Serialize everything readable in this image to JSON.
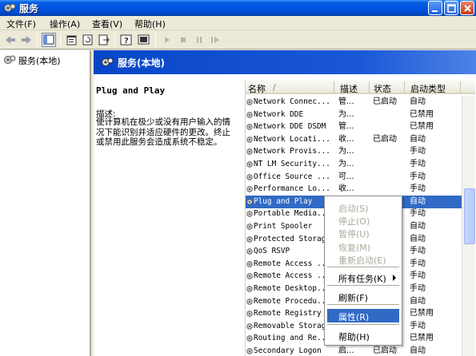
{
  "window": {
    "title": "服务",
    "accent": "#0054e3"
  },
  "menubar": {
    "items": [
      "文件(F)",
      "操作(A)",
      "查看(V)",
      "帮助(H)"
    ]
  },
  "toolbar": {
    "icons": [
      "back-arrow-icon",
      "forward-arrow-icon",
      "show-hide-tree-icon",
      "properties-icon",
      "refresh-icon",
      "export-list-icon",
      "help-icon",
      "console-icon",
      "start-service-icon",
      "stop-service-icon",
      "pause-service-icon",
      "restart-service-icon"
    ]
  },
  "tree": {
    "root_label": "服务(本地)"
  },
  "content": {
    "header_title": "服务(本地)",
    "selected_service": "Plug and Play",
    "description_label": "描述:",
    "description_text": "使计算机在极少或没有用户输入的情况下能识别并适应硬件的更改。终止或禁用此服务会造成系统不稳定。"
  },
  "list": {
    "columns": {
      "name": "名称",
      "sort_indicator": "/",
      "description": "描述",
      "status": "状态",
      "startup_type": "启动类型"
    },
    "rows": [
      {
        "name": "Network Connec...",
        "description": "管...",
        "status": "已启动",
        "startup_type": "自动"
      },
      {
        "name": "Network DDE",
        "description": "为...",
        "status": "",
        "startup_type": "已禁用"
      },
      {
        "name": "Network DDE DSDM",
        "description": "管...",
        "status": "",
        "startup_type": "已禁用"
      },
      {
        "name": "Network Locati...",
        "description": "收...",
        "status": "已启动",
        "startup_type": "自动"
      },
      {
        "name": "Network Provis...",
        "description": "为...",
        "status": "",
        "startup_type": "手动"
      },
      {
        "name": "NT LM Security...",
        "description": "为...",
        "status": "",
        "startup_type": "手动"
      },
      {
        "name": "Office Source ...",
        "description": "可...",
        "status": "",
        "startup_type": "手动"
      },
      {
        "name": "Performance Lo...",
        "description": "收...",
        "status": "",
        "startup_type": "手动"
      },
      {
        "name": "Plug and Play",
        "description": "",
        "status": "",
        "startup_type": "自动",
        "selected": true
      },
      {
        "name": "Portable Media...",
        "description": "",
        "status": "",
        "startup_type": "手动"
      },
      {
        "name": "Print Spooler",
        "description": "",
        "status": "",
        "startup_type": "自动"
      },
      {
        "name": "Protected Storage",
        "description": "",
        "status": "",
        "startup_type": "自动"
      },
      {
        "name": "QoS RSVP",
        "description": "",
        "status": "",
        "startup_type": "手动"
      },
      {
        "name": "Remote Access ...",
        "description": "",
        "status": "",
        "startup_type": "手动"
      },
      {
        "name": "Remote Access ...",
        "description": "",
        "status": "",
        "startup_type": "手动"
      },
      {
        "name": "Remote Desktop...",
        "description": "",
        "status": "",
        "startup_type": "手动"
      },
      {
        "name": "Remote Procedu...",
        "description": "",
        "status": "",
        "startup_type": "自动"
      },
      {
        "name": "Remote Registry",
        "description": "",
        "status": "",
        "startup_type": "已禁用"
      },
      {
        "name": "Removable Storage",
        "description": "",
        "status": "",
        "startup_type": "手动"
      },
      {
        "name": "Routing and Re...",
        "description": "",
        "status": "",
        "startup_type": "已禁用"
      },
      {
        "name": "Secondary Logon",
        "description": "启...",
        "status": "已启动",
        "startup_type": "自动"
      }
    ]
  },
  "context_menu": {
    "items": [
      {
        "label": "启动(S)",
        "disabled": true
      },
      {
        "label": "停止(O)",
        "disabled": true
      },
      {
        "label": "暂停(U)",
        "disabled": true
      },
      {
        "label": "恢复(M)",
        "disabled": true
      },
      {
        "label": "重新启动(E)",
        "disabled": true
      },
      {
        "label": "所有任务(K)",
        "disabled": false,
        "submenu": true
      },
      {
        "label": "刷新(F)",
        "disabled": false
      },
      {
        "label": "属性(R)",
        "disabled": false,
        "highlighted": true
      },
      {
        "label": "帮助(H)",
        "disabled": false
      }
    ]
  }
}
